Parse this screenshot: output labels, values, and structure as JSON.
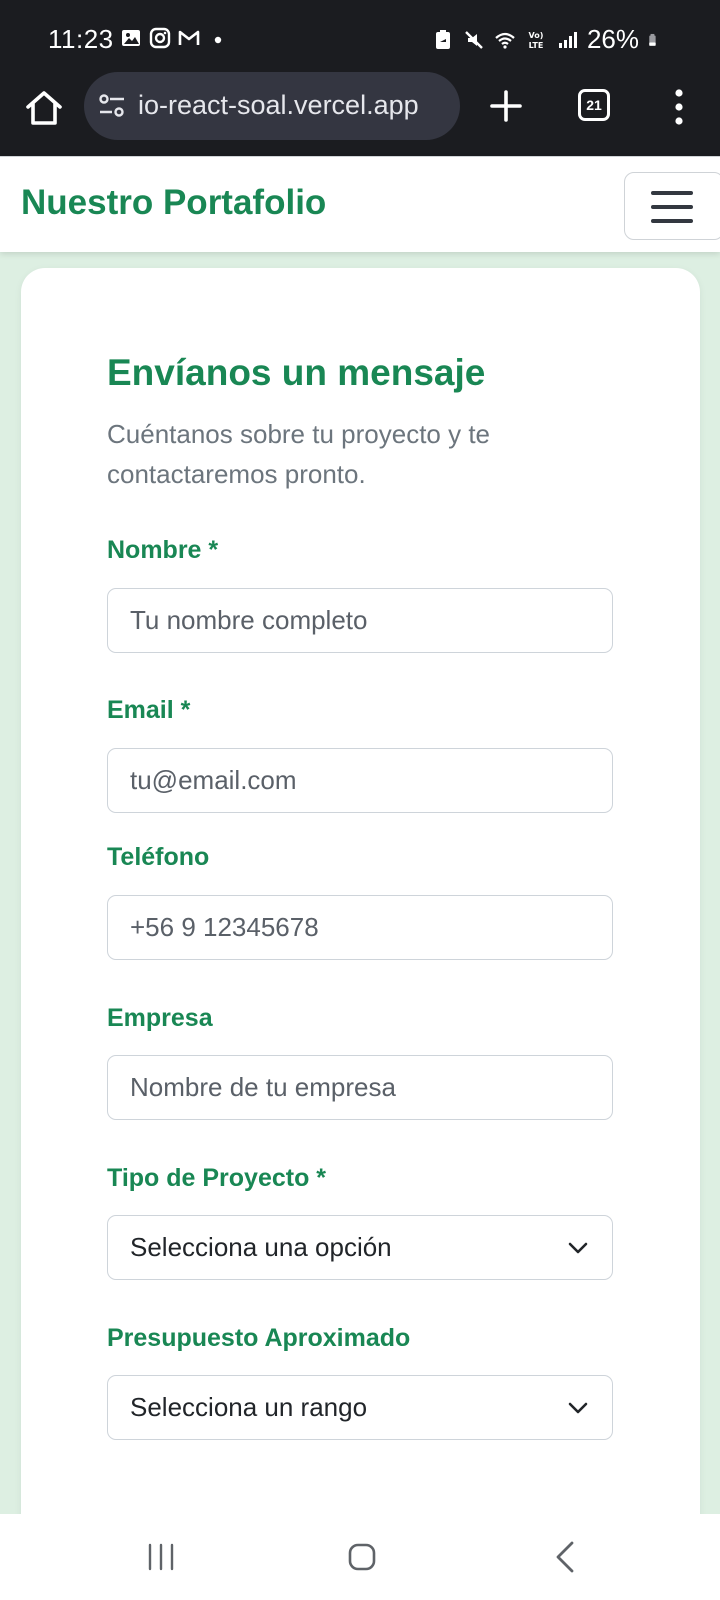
{
  "status_bar": {
    "time": "11:23",
    "battery": "26%",
    "left_icons": [
      "gallery-icon",
      "instagram-icon",
      "gmail-icon",
      "dot-icon"
    ],
    "right_icons": [
      "battery-saver-icon",
      "mute-icon",
      "wifi-icon",
      "volte-icon",
      "signal-icon",
      "battery-icon"
    ]
  },
  "browser": {
    "url": "io-react-soal.vercel.app",
    "tab_count": "21"
  },
  "navbar": {
    "brand": "Nuestro Portafolio"
  },
  "form": {
    "title": "Envíanos un mensaje",
    "subtitle": "Cuéntanos sobre tu proyecto y te contactaremos pronto.",
    "fields": {
      "nombre": {
        "label": "Nombre *",
        "placeholder": "Tu nombre completo",
        "value": ""
      },
      "email": {
        "label": "Email *",
        "placeholder": "tu@email.com",
        "value": ""
      },
      "telefono": {
        "label": "Teléfono",
        "placeholder": "+56 9 12345678",
        "value": ""
      },
      "empresa": {
        "label": "Empresa",
        "placeholder": "Nombre de tu empresa",
        "value": ""
      },
      "tipo_proyecto": {
        "label": "Tipo de Proyecto *",
        "selected": "Selecciona una opción"
      },
      "presupuesto": {
        "label": "Presupuesto Aproximado",
        "selected": "Selecciona un rango"
      }
    }
  },
  "colors": {
    "accent": "#198754",
    "page_background": "#ddefe2",
    "browser_chrome": "#1b1c20",
    "url_pill": "#343641",
    "muted_text": "#6c757d"
  }
}
